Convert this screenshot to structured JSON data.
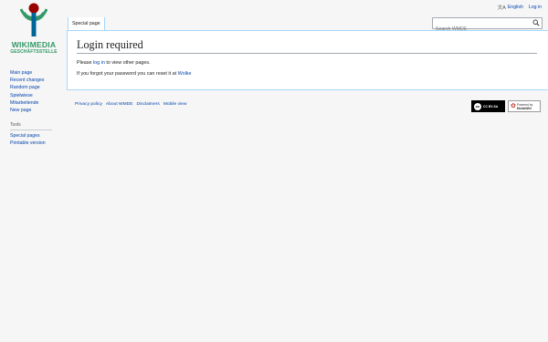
{
  "logo": {
    "line1": "WIKIMEDIA",
    "line2": "GESCHÄFTSSTELLE"
  },
  "personal": {
    "language": "English",
    "login": "Log in"
  },
  "tabs": [
    {
      "label": "Special page"
    }
  ],
  "search": {
    "placeholder": "Search WMDE"
  },
  "content": {
    "title": "Login required",
    "p1_pre": "Please ",
    "p1_link": "log in",
    "p1_post": " to view other pages.",
    "p2_pre": "If you forgot your password you can reset it at ",
    "p2_link": "Wolke"
  },
  "sidebar": {
    "navigation": [
      "Main page",
      "Recent changes",
      "Random page",
      "Spielwiese",
      "Mitarbeitende",
      "New page"
    ],
    "tools_heading": "Tools",
    "tools": [
      "Special pages",
      "Printable version"
    ]
  },
  "footer": {
    "links": [
      "Privacy policy",
      "About WMDE",
      "Disclaimers",
      "Mobile view"
    ],
    "badge_cc": "CC BY-SA",
    "badge_mw_top": "Powered by",
    "badge_mw_bottom": "MediaWiki"
  },
  "colors": {
    "logo_green": "#339966",
    "link": "#0645ad",
    "border": "#a7d7f9",
    "background": "#f6f6f6"
  }
}
